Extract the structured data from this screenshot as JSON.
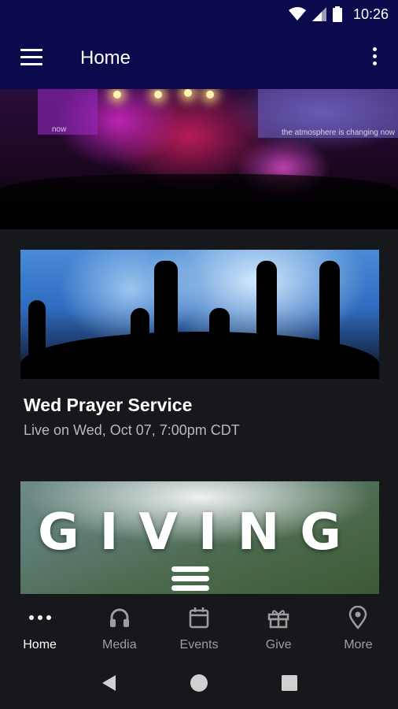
{
  "status_bar": {
    "time": "10:26"
  },
  "app_bar": {
    "title": "Home"
  },
  "hero": {
    "screen_caption_left": "now",
    "screen_caption_right": "the atmosphere is changing now"
  },
  "cards": [
    {
      "title": "Wed Prayer Service",
      "subtitle": "Live on Wed, Oct 07, 7:00pm CDT"
    },
    {
      "banner_text": "GIVING"
    }
  ],
  "bottom_nav": {
    "items": [
      {
        "label": "Home",
        "icon": "dots-icon",
        "active": true
      },
      {
        "label": "Media",
        "icon": "headphones-icon",
        "active": false
      },
      {
        "label": "Events",
        "icon": "calendar-icon",
        "active": false
      },
      {
        "label": "Give",
        "icon": "gift-icon",
        "active": false
      },
      {
        "label": "More",
        "icon": "location-pin-icon",
        "active": false
      }
    ]
  },
  "colors": {
    "app_bar": "#0b0a4d",
    "background": "#16181b",
    "inactive": "#9e9e9e"
  }
}
